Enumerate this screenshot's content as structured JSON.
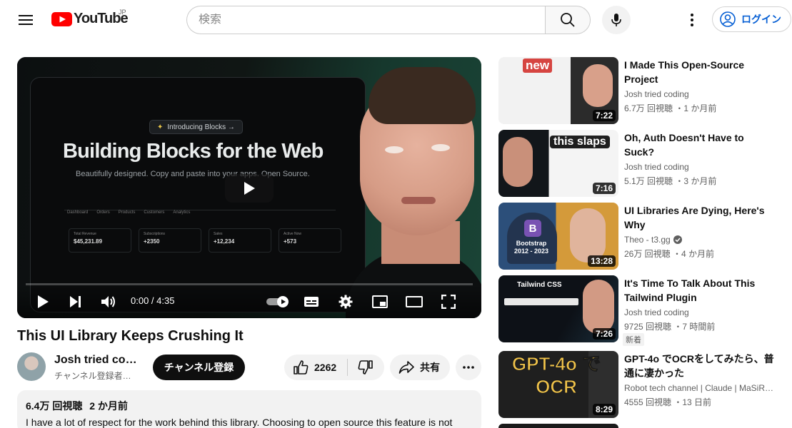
{
  "header": {
    "logo_text": "YouTube",
    "region": "JP",
    "search_placeholder": "検索",
    "login_label": "ログイン"
  },
  "player": {
    "thumb_pill": "Introducing Blocks →",
    "thumb_title": "Building Blocks for the Web",
    "thumb_subtitle": "Beautifully designed. Copy and paste into your apps. Open Source.",
    "dash_nav": [
      "Dashboard",
      "Orders",
      "Products",
      "Customers",
      "Analytics"
    ],
    "cards": [
      {
        "k": "Total Revenue",
        "v": "$45,231.89"
      },
      {
        "k": "Subscriptions",
        "v": "+2350"
      },
      {
        "k": "Sales",
        "v": "+12,234"
      },
      {
        "k": "Active Now",
        "v": "+573"
      }
    ],
    "time": "0:00 / 4:35",
    "progress": 0.0
  },
  "video": {
    "title": "This UI Library Keeps Crushing It",
    "channel_name": "Josh tried co…",
    "subscribers": "チャンネル登録者…",
    "subscribe_label": "チャンネル登録",
    "likes": "2262",
    "share_label": "共有",
    "views": "6.4万 回視聴",
    "published": "2 か月前",
    "description": "I have a lot of respect for the work behind this library. Choosing to open source this feature is not"
  },
  "related": [
    {
      "title": "I Made This Open-Source Project",
      "channel": "Josh tried coding",
      "verified": false,
      "meta": "6.7万 回視聴 ・1 か月前",
      "duration": "7:22",
      "badge": "",
      "thumb_caption": "new",
      "thumb_colors": [
        "#f4f4f4",
        "#d64541"
      ]
    },
    {
      "title": "Oh, Auth Doesn't Have to Suck?",
      "channel": "Josh tried coding",
      "verified": false,
      "meta": "5.1万 回視聴 ・3 か月前",
      "duration": "7:16",
      "badge": "",
      "thumb_caption": "this slaps",
      "thumb_colors": [
        "#12161a",
        "#2e7d57"
      ]
    },
    {
      "title": "UI Libraries Are Dying, Here's Why",
      "channel": "Theo - t3.gg",
      "verified": true,
      "meta": "26万 回視聴 ・4 か月前",
      "duration": "13:28",
      "badge": "",
      "thumb_caption": "Bootstrap 2012 - 2023",
      "thumb_colors": [
        "#3a5a8a",
        "#d6a03a"
      ]
    },
    {
      "title": "It's Time To Talk About This Tailwind Plugin",
      "channel": "Josh tried coding",
      "verified": false,
      "meta": "9725 回視聴 ・7 時間前",
      "duration": "7:26",
      "badge": "新着",
      "thumb_caption": "Tailwind CSS",
      "thumb_colors": [
        "#0d1117",
        "#1b2f3c"
      ]
    },
    {
      "title": "GPT-4o でOCRをしてみたら、普通に凄かった",
      "channel": "Robot tech channel | Claude | MaSiR…",
      "verified": false,
      "meta": "4555 回視聴 ・13 日前",
      "duration": "8:29",
      "badge": "",
      "thumb_caption": "GPT-4o で OCR",
      "thumb_colors": [
        "#1f1f1f",
        "#d8a01a"
      ]
    }
  ]
}
